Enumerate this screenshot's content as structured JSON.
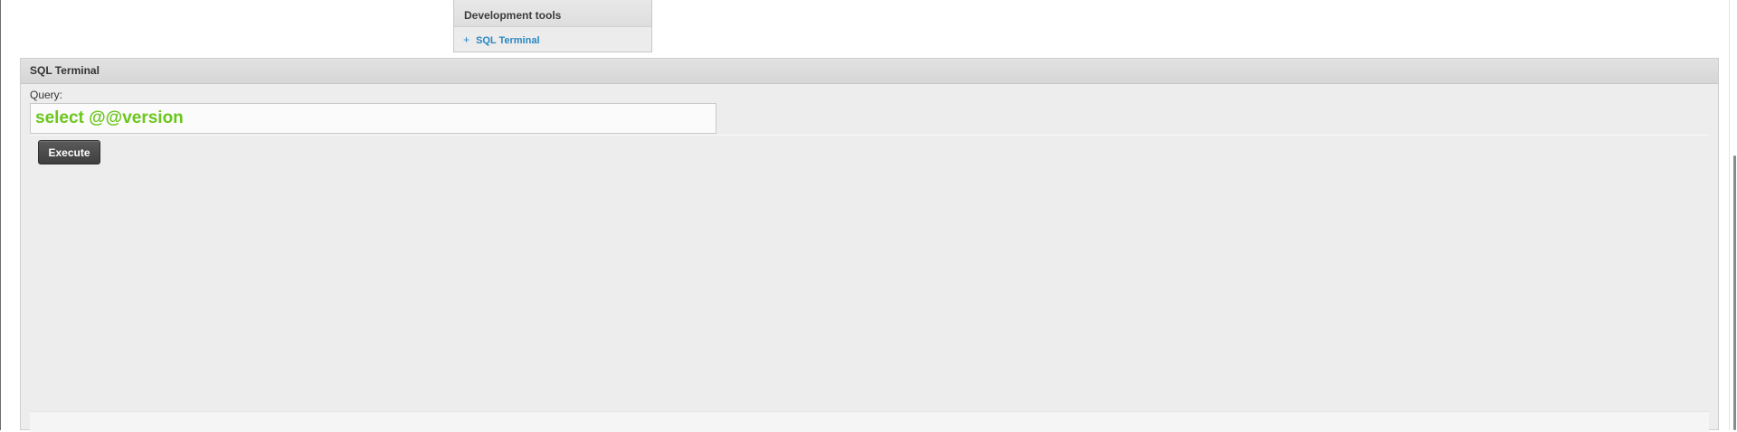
{
  "dev_tools": {
    "header": "Development tools",
    "items": [
      {
        "icon": "plus-icon",
        "glyph": "+",
        "label": "SQL Terminal"
      }
    ]
  },
  "sql_terminal": {
    "title": "SQL Terminal",
    "query_label": "Query:",
    "query_value": "select @@version",
    "execute_label": "Execute"
  },
  "colors": {
    "query_text": "#6cc61c",
    "link": "#2a87c2",
    "button_bg": "#4a4a4a"
  }
}
